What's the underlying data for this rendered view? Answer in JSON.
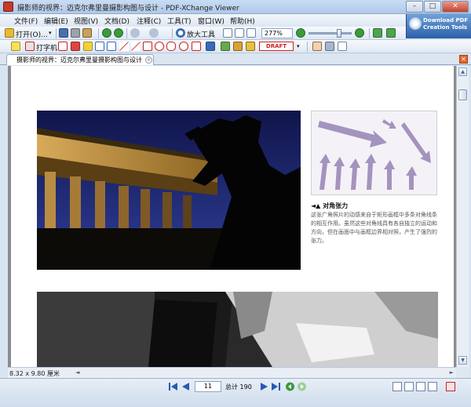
{
  "window": {
    "title": "摄影师的视界：迈克尔弗里曼摄影构图与设计 - PDF-XChange Viewer",
    "minimize": "–",
    "maximize": "□",
    "close": "✕"
  },
  "menu": {
    "items": [
      "文件(F)",
      "编辑(E)",
      "视图(V)",
      "文档(D)",
      "注释(C)",
      "工具(T)",
      "窗口(W)",
      "帮助(H)"
    ]
  },
  "promo": {
    "line1": "Download PDF",
    "line2": "Creation Tools"
  },
  "toolbar1": {
    "open_label": "打开(O)...",
    "zoom_tool_label": "放大工具",
    "zoom_value": "277%",
    "zoom_slider_fraction": 0.7
  },
  "toolbar2": {
    "typewriter_label": "打字机",
    "stamp_label": "DRAFT"
  },
  "tab": {
    "label": "摄影师的视界：迈克尔弗里曼摄影构图与设计",
    "close": "×",
    "close_all": "✕"
  },
  "page_content": {
    "caption_title": "◄▲ 对角张力",
    "caption_body": "这张广角照片的动感来自于矩形画框中多条对角线条的相互作用。虽然这些对角线具有各自独立的运动和方向，但在画面中与画框边界相对照，产生了强烈的张力。"
  },
  "scroll": {
    "up": "▲",
    "down": "▼",
    "left": "◄",
    "right": "►"
  },
  "status": {
    "dimensions": "8.32 x 9.80 厘米",
    "current_page": "11",
    "total_pages": "总计 190"
  },
  "colors": {
    "accent": "#2d5fa8",
    "nav_blue": "#2a58b5",
    "nav_green": "#3c9a3c",
    "draft_red": "#cc2222"
  }
}
